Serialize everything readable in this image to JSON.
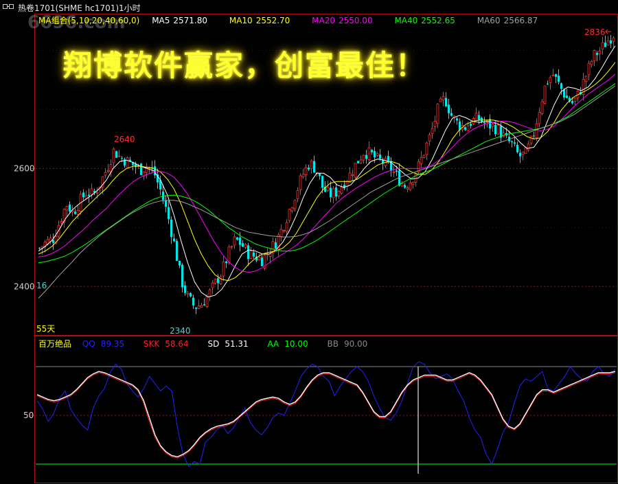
{
  "window": {
    "title": "热卷1701(SHME hc1701)1小时",
    "watermark": "6696.com"
  },
  "banner": "翔博软件赢家，创富最佳！",
  "ma_legend": {
    "group_label": "MA组合(5,10,20,40,60,0)",
    "items": [
      {
        "name": "MA5",
        "value": "2571.80",
        "color": "#ffffff"
      },
      {
        "name": "MA10",
        "value": "2552.70",
        "color": "#ffff00"
      },
      {
        "name": "MA20",
        "value": "2550.00",
        "color": "#ff00ff"
      },
      {
        "name": "MA40",
        "value": "2552.65",
        "color": "#00ff00"
      },
      {
        "name": "MA60",
        "value": "2566.87",
        "color": "#a0a0a0"
      }
    ]
  },
  "indicator_legend": {
    "name": "百万绝品",
    "items": [
      {
        "name": "QQ",
        "value": "89.35",
        "color": "#2222ff"
      },
      {
        "name": "SKK",
        "value": "58.64",
        "color": "#ff2020"
      },
      {
        "name": "SD",
        "value": "51.31",
        "color": "#ffffff"
      },
      {
        "name": "AA",
        "value": "10.00",
        "color": "#00ff00"
      },
      {
        "name": "BB",
        "value": "90.00",
        "color": "#888888"
      }
    ]
  },
  "chart_data": [
    {
      "type": "candlestick",
      "title": "热卷1701(SHME hc1701)1小时",
      "y_ticks": [
        "2600",
        "2400"
      ],
      "ylim": [
        2320,
        2860
      ],
      "annotations": [
        {
          "text": "2640",
          "type": "high"
        },
        {
          "text": "2340",
          "type": "low"
        },
        {
          "text": "2836",
          "type": "high"
        },
        {
          "text": "16",
          "type": "left-label"
        },
        {
          "text": "55天",
          "type": "left-label"
        }
      ],
      "colors": {
        "up": "#ff3030",
        "down": "#00e5e5"
      },
      "close_path": [
        2465,
        2475,
        2480,
        2510,
        2540,
        2525,
        2545,
        2560,
        2555,
        2575,
        2600,
        2630,
        2618,
        2612,
        2605,
        2598,
        2605,
        2592,
        2560,
        2520,
        2470,
        2410,
        2380,
        2365,
        2370,
        2385,
        2405,
        2425,
        2455,
        2480,
        2470,
        2455,
        2450,
        2445,
        2460,
        2475,
        2500,
        2530,
        2560,
        2590,
        2610,
        2598,
        2565,
        2555,
        2560,
        2575,
        2590,
        2610,
        2628,
        2625,
        2615,
        2610,
        2600,
        2585,
        2570,
        2580,
        2600,
        2630,
        2660,
        2700,
        2720,
        2690,
        2675,
        2670,
        2680,
        2685,
        2675,
        2672,
        2665,
        2650,
        2640,
        2620,
        2625,
        2650,
        2700,
        2745,
        2760,
        2740,
        2720,
        2710,
        2730,
        2760,
        2790,
        2800,
        2815,
        2828
      ],
      "ma_series": [
        {
          "name": "MA5",
          "color": "#ffffff",
          "values": [
            2460,
            2468,
            2478,
            2495,
            2515,
            2530,
            2540,
            2548,
            2556,
            2566,
            2580,
            2600,
            2612,
            2614,
            2610,
            2604,
            2600,
            2596,
            2580,
            2555,
            2520,
            2478,
            2440,
            2408,
            2390,
            2382,
            2385,
            2395,
            2412,
            2435,
            2455,
            2462,
            2460,
            2455,
            2455,
            2462,
            2475,
            2495,
            2520,
            2550,
            2575,
            2592,
            2592,
            2585,
            2572,
            2568,
            2572,
            2585,
            2600,
            2612,
            2616,
            2614,
            2610,
            2600,
            2590,
            2582,
            2584,
            2595,
            2615,
            2640,
            2665,
            2685,
            2690,
            2686,
            2680,
            2678,
            2680,
            2678,
            2674,
            2666,
            2656,
            2644,
            2634,
            2636,
            2652,
            2680,
            2708,
            2730,
            2738,
            2736,
            2732,
            2738,
            2752,
            2770,
            2790,
            2808
          ]
        },
        {
          "name": "MA10",
          "color": "#ffff00",
          "values": [
            2455,
            2460,
            2468,
            2480,
            2495,
            2510,
            2522,
            2534,
            2545,
            2556,
            2566,
            2580,
            2592,
            2600,
            2604,
            2604,
            2602,
            2600,
            2594,
            2582,
            2565,
            2540,
            2510,
            2480,
            2455,
            2435,
            2420,
            2412,
            2410,
            2415,
            2425,
            2438,
            2448,
            2455,
            2458,
            2460,
            2465,
            2475,
            2490,
            2510,
            2530,
            2550,
            2565,
            2575,
            2578,
            2578,
            2578,
            2582,
            2590,
            2598,
            2606,
            2610,
            2612,
            2608,
            2600,
            2594,
            2590,
            2590,
            2598,
            2612,
            2630,
            2650,
            2665,
            2675,
            2680,
            2682,
            2682,
            2682,
            2680,
            2676,
            2670,
            2662,
            2654,
            2650,
            2652,
            2662,
            2678,
            2698,
            2712,
            2722,
            2728,
            2734,
            2742,
            2752,
            2765,
            2780
          ]
        },
        {
          "name": "MA20",
          "color": "#ff00ff",
          "values": [
            2450,
            2452,
            2456,
            2462,
            2470,
            2480,
            2490,
            2500,
            2512,
            2522,
            2532,
            2545,
            2557,
            2568,
            2578,
            2585,
            2590,
            2594,
            2595,
            2592,
            2585,
            2572,
            2556,
            2536,
            2515,
            2494,
            2474,
            2456,
            2442,
            2432,
            2426,
            2424,
            2426,
            2432,
            2440,
            2448,
            2455,
            2462,
            2470,
            2480,
            2492,
            2505,
            2518,
            2530,
            2542,
            2552,
            2560,
            2568,
            2575,
            2582,
            2588,
            2593,
            2597,
            2600,
            2600,
            2600,
            2600,
            2602,
            2606,
            2614,
            2624,
            2636,
            2648,
            2658,
            2666,
            2672,
            2676,
            2678,
            2680,
            2680,
            2678,
            2674,
            2670,
            2666,
            2664,
            2666,
            2672,
            2682,
            2694,
            2706,
            2716,
            2726,
            2734,
            2742,
            2750,
            2760
          ]
        },
        {
          "name": "MA40",
          "color": "#00ff00",
          "values": [
            2440,
            2442,
            2445,
            2448,
            2452,
            2458,
            2465,
            2472,
            2480,
            2488,
            2496,
            2504,
            2512,
            2520,
            2528,
            2535,
            2542,
            2548,
            2552,
            2554,
            2555,
            2553,
            2550,
            2545,
            2538,
            2530,
            2520,
            2510,
            2500,
            2492,
            2484,
            2478,
            2472,
            2468,
            2465,
            2462,
            2460,
            2460,
            2462,
            2466,
            2472,
            2478,
            2486,
            2494,
            2502,
            2510,
            2518,
            2526,
            2534,
            2542,
            2550,
            2558,
            2565,
            2572,
            2578,
            2584,
            2590,
            2594,
            2598,
            2604,
            2610,
            2616,
            2622,
            2628,
            2634,
            2640,
            2646,
            2650,
            2654,
            2658,
            2660,
            2662,
            2664,
            2666,
            2668,
            2672,
            2676,
            2682,
            2688,
            2696,
            2704,
            2712,
            2720,
            2728,
            2736,
            2744
          ]
        },
        {
          "name": "MA60",
          "color": "#a0a0a0",
          "values": [
            2380,
            2392,
            2405,
            2418,
            2430,
            2442,
            2455,
            2466,
            2476,
            2486,
            2495,
            2503,
            2511,
            2519,
            2526,
            2532,
            2538,
            2542,
            2545,
            2546,
            2546,
            2544,
            2540,
            2535,
            2530,
            2524,
            2518,
            2512,
            2506,
            2500,
            2496,
            2492,
            2490,
            2488,
            2486,
            2485,
            2484,
            2484,
            2485,
            2488,
            2492,
            2498,
            2505,
            2512,
            2520,
            2528,
            2536,
            2544,
            2552,
            2560,
            2566,
            2572,
            2578,
            2584,
            2588,
            2592,
            2596,
            2600,
            2604,
            2608,
            2612,
            2616,
            2620,
            2624,
            2628,
            2632,
            2636,
            2640,
            2644,
            2648,
            2652,
            2656,
            2660,
            2664,
            2668,
            2672,
            2676,
            2680,
            2686,
            2692,
            2700,
            2708,
            2716,
            2724,
            2732,
            2740
          ]
        }
      ]
    },
    {
      "type": "line",
      "y_ticks": [
        "50"
      ],
      "ylim": [
        0,
        100
      ],
      "hlines": [
        {
          "name": "AA",
          "value": 10,
          "color": "#00ff00"
        },
        {
          "name": "BB",
          "value": 90,
          "color": "#888888"
        }
      ],
      "series": [
        {
          "name": "QQ",
          "color": "#2222ff",
          "values": [
            62,
            55,
            45,
            52,
            64,
            70,
            55,
            48,
            42,
            38,
            56,
            66,
            72,
            85,
            92,
            88,
            76,
            70,
            65,
            72,
            82,
            76,
            70,
            74,
            70,
            40,
            18,
            8,
            12,
            10,
            28,
            32,
            38,
            42,
            35,
            40,
            48,
            56,
            44,
            38,
            34,
            40,
            48,
            52,
            50,
            60,
            70,
            82,
            88,
            92,
            90,
            82,
            78,
            66,
            74,
            80,
            86,
            90,
            86,
            78,
            66,
            56,
            48,
            46,
            52,
            62,
            76,
            90,
            94,
            92,
            85,
            80,
            82,
            84,
            80,
            70,
            62,
            48,
            38,
            32,
            18,
            10,
            22,
            36,
            44,
            60,
            74,
            80,
            78,
            82,
            86,
            72,
            70,
            76,
            82,
            90,
            84,
            80,
            78,
            86,
            90,
            84,
            82,
            88
          ]
        },
        {
          "name": "SKK",
          "color": "#ff2020",
          "values": [
            66,
            64,
            62,
            61,
            62,
            64,
            66,
            70,
            75,
            80,
            83,
            85,
            84,
            82,
            80,
            78,
            76,
            74,
            70,
            60,
            45,
            32,
            24,
            19,
            16,
            15,
            17,
            20,
            25,
            31,
            35,
            38,
            40,
            41,
            42,
            44,
            48,
            52,
            56,
            60,
            62,
            63,
            64,
            63,
            60,
            58,
            60,
            65,
            72,
            78,
            82,
            84,
            84,
            82,
            80,
            78,
            76,
            74,
            68,
            60,
            52,
            48,
            48,
            52,
            60,
            68,
            74,
            78,
            80,
            82,
            82,
            82,
            80,
            78,
            78,
            80,
            82,
            84,
            82,
            78,
            72,
            66,
            56,
            46,
            40,
            38,
            42,
            50,
            58,
            66,
            70,
            70,
            68,
            70,
            72,
            74,
            76,
            78,
            80,
            82,
            84,
            84,
            84,
            85
          ]
        },
        {
          "name": "SD",
          "color": "#ffffff",
          "values": [
            67,
            65,
            63,
            62,
            63,
            65,
            67,
            71,
            76,
            81,
            84,
            86,
            85,
            83,
            81,
            79,
            77,
            75,
            71,
            62,
            48,
            34,
            25,
            20,
            17,
            16,
            18,
            21,
            26,
            32,
            36,
            39,
            41,
            42,
            43,
            45,
            49,
            53,
            57,
            61,
            63,
            64,
            65,
            64,
            61,
            59,
            61,
            66,
            73,
            79,
            83,
            85,
            85,
            83,
            81,
            79,
            77,
            75,
            69,
            61,
            53,
            49,
            49,
            53,
            61,
            69,
            75,
            79,
            81,
            83,
            83,
            83,
            81,
            79,
            79,
            81,
            83,
            85,
            83,
            79,
            73,
            67,
            57,
            47,
            41,
            39,
            43,
            51,
            59,
            67,
            71,
            71,
            69,
            71,
            73,
            75,
            77,
            79,
            81,
            83,
            85,
            85,
            85,
            86
          ]
        }
      ]
    }
  ]
}
